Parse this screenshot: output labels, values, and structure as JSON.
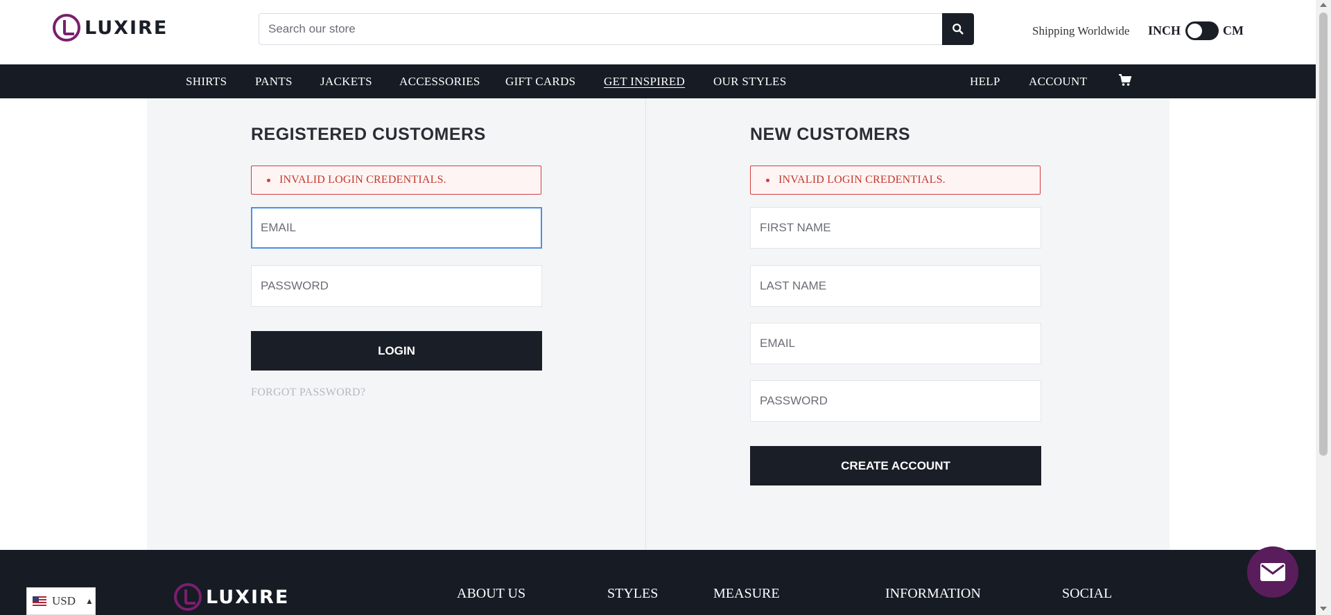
{
  "header": {
    "logo_text": "LUXIRE",
    "search_placeholder": "Search our store",
    "shipping": "Shipping Worldwide",
    "unit_inch": "INCH",
    "unit_cm": "CM"
  },
  "nav": {
    "items": [
      "SHIRTS",
      "PANTS",
      "JACKETS",
      "ACCESSORIES",
      "GIFT CARDS",
      "GET INSPIRED",
      "OUR STYLES"
    ],
    "help": "HELP",
    "account": "ACCOUNT"
  },
  "registered": {
    "title": "REGISTERED CUSTOMERS",
    "error": "INVALID LOGIN CREDENTIALS.",
    "email_placeholder": "EMAIL",
    "password_placeholder": "PASSWORD",
    "login_label": "LOGIN",
    "forgot_label": "FORGOT PASSWORD?"
  },
  "new_customers": {
    "title": "NEW CUSTOMERS",
    "error": "INVALID LOGIN CREDENTIALS.",
    "first_name_placeholder": "FIRST NAME",
    "last_name_placeholder": "LAST NAME",
    "email_placeholder": "EMAIL",
    "password_placeholder": "PASSWORD",
    "create_label": "CREATE ACCOUNT"
  },
  "footer": {
    "logo_text": "LUXIRE",
    "columns": [
      "ABOUT US",
      "STYLES",
      "MEASURE",
      "INFORMATION",
      "SOCIAL"
    ]
  },
  "currency": {
    "code": "USD"
  },
  "colors": {
    "dark": "#161b24",
    "brand_purple": "#7a1f6e",
    "error_red": "#d23c3c"
  }
}
